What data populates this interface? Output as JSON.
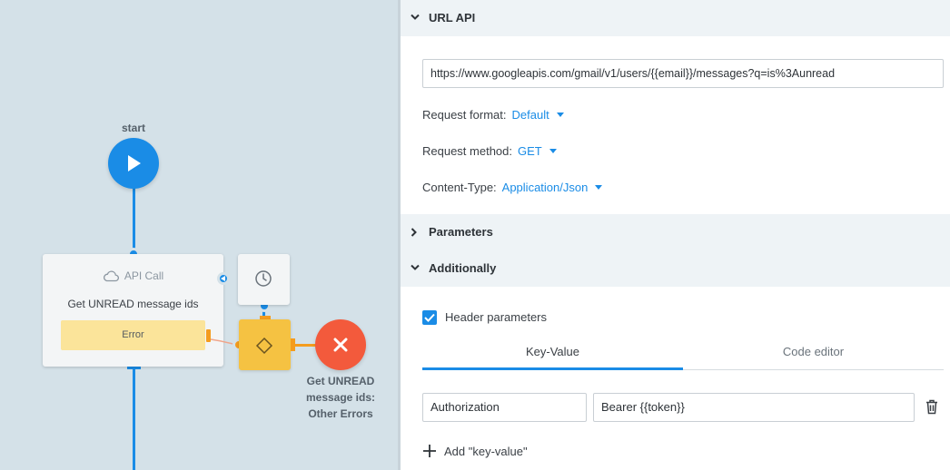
{
  "canvas": {
    "start_label": "start",
    "api_node": {
      "type_label": "API Call",
      "title": "Get UNREAD message ids",
      "error_label": "Error"
    },
    "end_node": {
      "label_line1": "Get UNREAD",
      "label_line2": "message ids:",
      "label_line3": "Other Errors"
    },
    "icons": [
      "play-icon",
      "cloud-icon",
      "clock-icon",
      "diamond-icon",
      "close-icon"
    ],
    "colors": {
      "background": "#d4e1e8",
      "flow": "#1a8ce6",
      "condition": "#f5c242",
      "error_end": "#f35a3c",
      "error_bar": "#fbe49a"
    }
  },
  "panel": {
    "url_section": {
      "title": "URL API",
      "url": "https://www.googleapis.com/gmail/v1/users/{{email}}/messages?q=is%3Aunread"
    },
    "request_format": {
      "label": "Request format:",
      "value": "Default"
    },
    "request_method": {
      "label": "Request method:",
      "value": "GET"
    },
    "content_type": {
      "label": "Content-Type:",
      "value": "Application/Json"
    },
    "parameters_section": {
      "title": "Parameters"
    },
    "additionally_section": {
      "title": "Additionally",
      "header_parameters_label": "Header parameters",
      "header_parameters_checked": true,
      "tabs": [
        {
          "label": "Key-Value",
          "active": true
        },
        {
          "label": "Code editor",
          "active": false
        }
      ],
      "rows": [
        {
          "key": "Authorization",
          "value": "Bearer {{token}}"
        }
      ],
      "add_label": "Add \"key-value\""
    },
    "colors": {
      "accent": "#1a8ce6",
      "section_bg": "#eef3f6"
    }
  }
}
